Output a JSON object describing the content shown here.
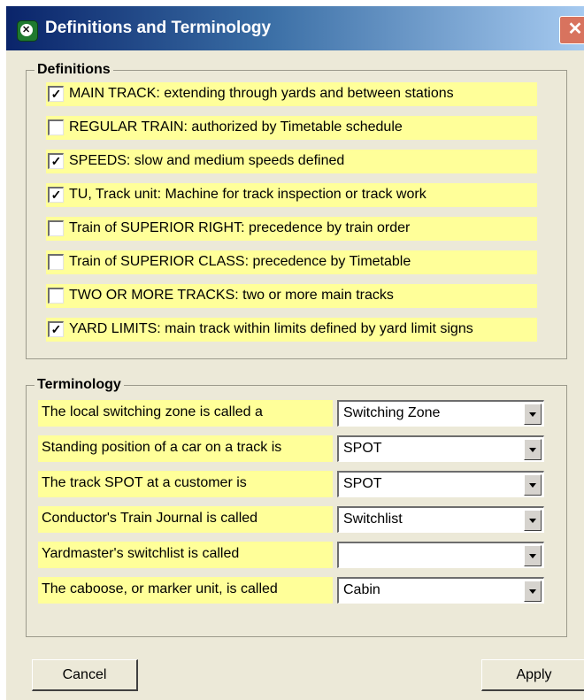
{
  "window": {
    "title": "Definitions and Terminology",
    "close_glyph": "✕"
  },
  "definitions": {
    "group_label": "Definitions",
    "items": [
      {
        "label": "MAIN TRACK: extending through yards and between stations",
        "checked": true
      },
      {
        "label": "REGULAR TRAIN: authorized by Timetable schedule",
        "checked": false
      },
      {
        "label": "SPEEDS: slow and medium  speeds defined",
        "checked": true
      },
      {
        "label": "TU, Track unit: Machine for track inspection or track work",
        "checked": true
      },
      {
        "label": "Train of SUPERIOR RIGHT: precedence by train order",
        "checked": false
      },
      {
        "label": "Train of SUPERIOR CLASS: precedence by Timetable",
        "checked": false
      },
      {
        "label": "TWO OR MORE TRACKS: two or more main tracks",
        "checked": false
      },
      {
        "label": "YARD LIMITS: main track within limits defined by yard limit signs",
        "checked": true
      }
    ]
  },
  "terminology": {
    "group_label": "Terminology",
    "rows": [
      {
        "label": "The local switching zone is called a",
        "value": "Switching Zone"
      },
      {
        "label": "Standing position of a car on a track is",
        "value": "SPOT"
      },
      {
        "label": "The track SPOT at a customer is",
        "value": "SPOT"
      },
      {
        "label": "Conductor's Train Journal is called",
        "value": "Switchlist"
      },
      {
        "label": "Yardmaster's switchlist is called",
        "value": ""
      },
      {
        "label": "The caboose, or marker unit, is called",
        "value": "Cabin"
      }
    ]
  },
  "buttons": {
    "cancel": "Cancel",
    "apply": "Apply"
  },
  "icons": {
    "app": "app-icon",
    "close": "close-icon",
    "check": "checkmark-icon",
    "dropdown": "dropdown-arrow-icon"
  },
  "colors": {
    "highlight": "#ffff99",
    "dialog_bg": "#ece9d8",
    "title_start": "#0a246a",
    "close": "#d8735e"
  }
}
